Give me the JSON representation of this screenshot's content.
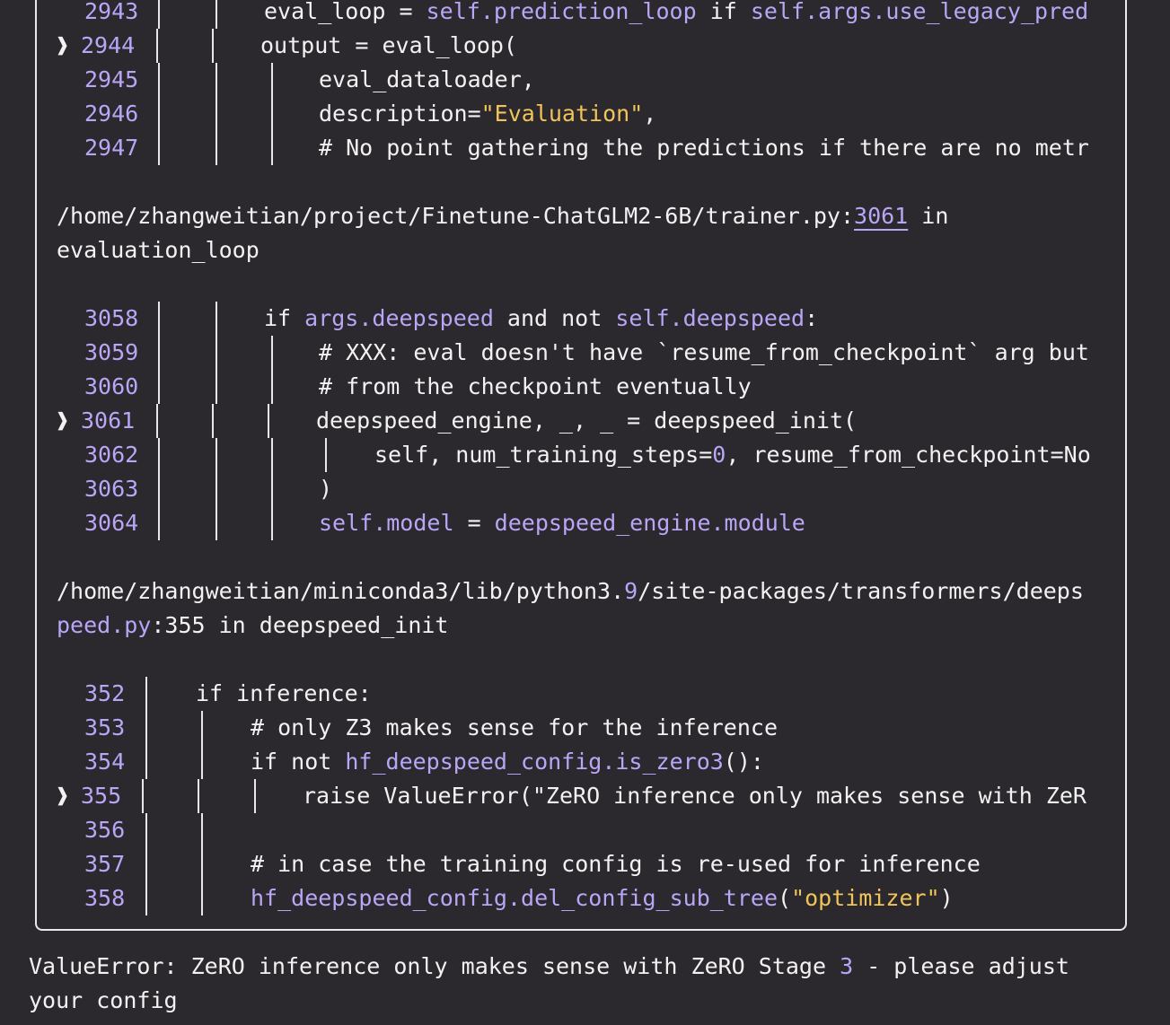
{
  "frames": [
    {
      "lines": [
        {
          "no": "2943",
          "active": false,
          "code": [
            {
              "t": "eval_loop = ",
              "c": "kw"
            },
            {
              "t": "self.prediction_loop",
              "c": "attr"
            },
            {
              "t": " if ",
              "c": "kw"
            },
            {
              "t": "self.args.use_legacy_pred",
              "c": "attr"
            }
          ]
        },
        {
          "no": "2944",
          "active": true,
          "code": [
            {
              "t": "output = eval_loop(",
              "c": "kw"
            }
          ]
        },
        {
          "no": "2945",
          "active": false,
          "code": [
            {
              "t": "eval_dataloader,",
              "c": "kw"
            }
          ]
        },
        {
          "no": "2946",
          "active": false,
          "code": [
            {
              "t": "description=",
              "c": "kw"
            },
            {
              "t": "\"Evaluation\"",
              "c": "str"
            },
            {
              "t": ",",
              "c": "kw"
            }
          ]
        },
        {
          "no": "2947",
          "active": false,
          "code": [
            {
              "t": "# No point gathering the predictions if there are no metr",
              "c": "kw"
            }
          ]
        }
      ]
    },
    {
      "path_line1": "/home/zhangweitian/project/Finetune-ChatGLM2-6B/trainer.py:",
      "path_lineno": "3061",
      "path_in": " in",
      "path_line2": "evaluation_loop",
      "lines": [
        {
          "no": "3058",
          "active": false,
          "code": [
            {
              "t": "if ",
              "c": "kw"
            },
            {
              "t": "args.deepspeed",
              "c": "attr"
            },
            {
              "t": " and not ",
              "c": "kw"
            },
            {
              "t": "self.deepspeed",
              "c": "attr"
            },
            {
              "t": ":",
              "c": "kw"
            }
          ]
        },
        {
          "no": "3059",
          "active": false,
          "code": [
            {
              "t": "# XXX: eval doesn't have `resume_from_checkpoint` arg but",
              "c": "kw"
            }
          ]
        },
        {
          "no": "3060",
          "active": false,
          "code": [
            {
              "t": "# from the checkpoint eventually",
              "c": "kw"
            }
          ]
        },
        {
          "no": "3061",
          "active": true,
          "code": [
            {
              "t": "deepspeed_engine, _, _ = deepspeed_init(",
              "c": "kw"
            }
          ]
        },
        {
          "no": "3062",
          "active": false,
          "code": [
            {
              "t": "self, num_training_steps=",
              "c": "kw"
            },
            {
              "t": "0",
              "c": "attr"
            },
            {
              "t": ", resume_from_checkpoint=No",
              "c": "kw"
            }
          ]
        },
        {
          "no": "3063",
          "active": false,
          "code": [
            {
              "t": ")",
              "c": "kw"
            }
          ]
        },
        {
          "no": "3064",
          "active": false,
          "code": [
            {
              "t": "self.model",
              "c": "attr"
            },
            {
              "t": " = ",
              "c": "kw"
            },
            {
              "t": "deepspeed_engine.module",
              "c": "attr"
            }
          ]
        }
      ]
    },
    {
      "path_line1a": "/home/zhangweitian/miniconda3/lib/python3.",
      "path_line1b": "9",
      "path_line1c": "/site-packages/transformers/deeps",
      "path_line2a": "peed.py",
      "path_line2b": ":355 in deepspeed_init",
      "lines": [
        {
          "no": "352",
          "active": false,
          "code": [
            {
              "t": "if inference:",
              "c": "kw"
            }
          ]
        },
        {
          "no": "353",
          "active": false,
          "code": [
            {
              "t": "# only Z3 makes sense for the inference",
              "c": "kw"
            }
          ]
        },
        {
          "no": "354",
          "active": false,
          "code": [
            {
              "t": "if not ",
              "c": "kw"
            },
            {
              "t": "hf_deepspeed_config.is_zero3",
              "c": "attr"
            },
            {
              "t": "():",
              "c": "kw"
            }
          ]
        },
        {
          "no": "355",
          "active": true,
          "code": [
            {
              "t": "raise ValueError(\"ZeRO inference only makes sense with ZeR",
              "c": "kw"
            }
          ]
        },
        {
          "no": "356",
          "active": false,
          "code": []
        },
        {
          "no": "357",
          "active": false,
          "code": [
            {
              "t": "# in case the training config is re-used for inference",
              "c": "kw"
            }
          ]
        },
        {
          "no": "358",
          "active": false,
          "code": [
            {
              "t": "hf_deepspeed_config.del_config_sub_tree",
              "c": "attr"
            },
            {
              "t": "(",
              "c": "kw"
            },
            {
              "t": "\"optimizer\"",
              "c": "str"
            },
            {
              "t": ")",
              "c": "kw"
            }
          ]
        }
      ]
    }
  ],
  "error": {
    "line1a": "ValueError: ZeRO inference only makes sense with ZeRO Stage ",
    "line1b": "3",
    "line1c": " - please adjust",
    "line2": "your config"
  },
  "active_marker": "❱",
  "colors": {
    "background": "#2b292e",
    "text": "#f2f2f2",
    "accent": "#b9a6f6",
    "string": "#f0c45a"
  }
}
